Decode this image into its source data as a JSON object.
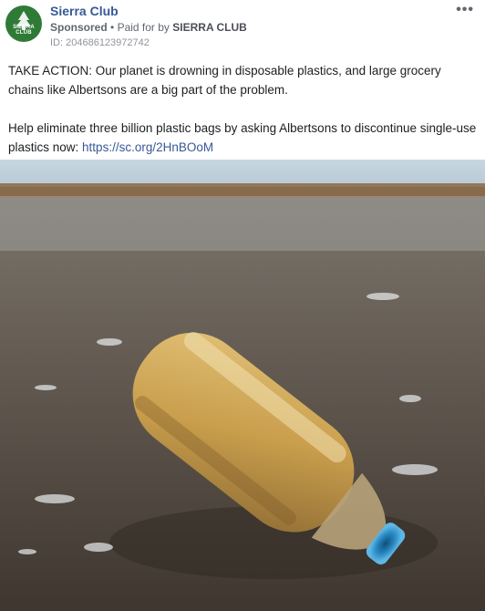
{
  "post": {
    "page_name": "Sierra Club",
    "avatar_text": [
      "SIERRA",
      "CLUB"
    ],
    "sponsored_label": "Sponsored",
    "separator": "•",
    "paid_for_prefix": "Paid for by",
    "paid_for_by": "SIERRA CLUB",
    "ad_id": "ID: 204686123972742",
    "more_icon": "more-options-icon",
    "paragraph1": "TAKE ACTION: Our planet is drowning in disposable plastics, and large grocery chains like Albertsons are a big part of the problem.",
    "paragraph2_text": "Help eliminate three billion plastic bags by asking Albertsons to discontinue single-use plastics now: ",
    "paragraph2_link": "https://sc.org/2HnBOoM"
  },
  "colors": {
    "link": "#385898",
    "brand_green": "#2f7a37",
    "page_name": "#365899"
  }
}
